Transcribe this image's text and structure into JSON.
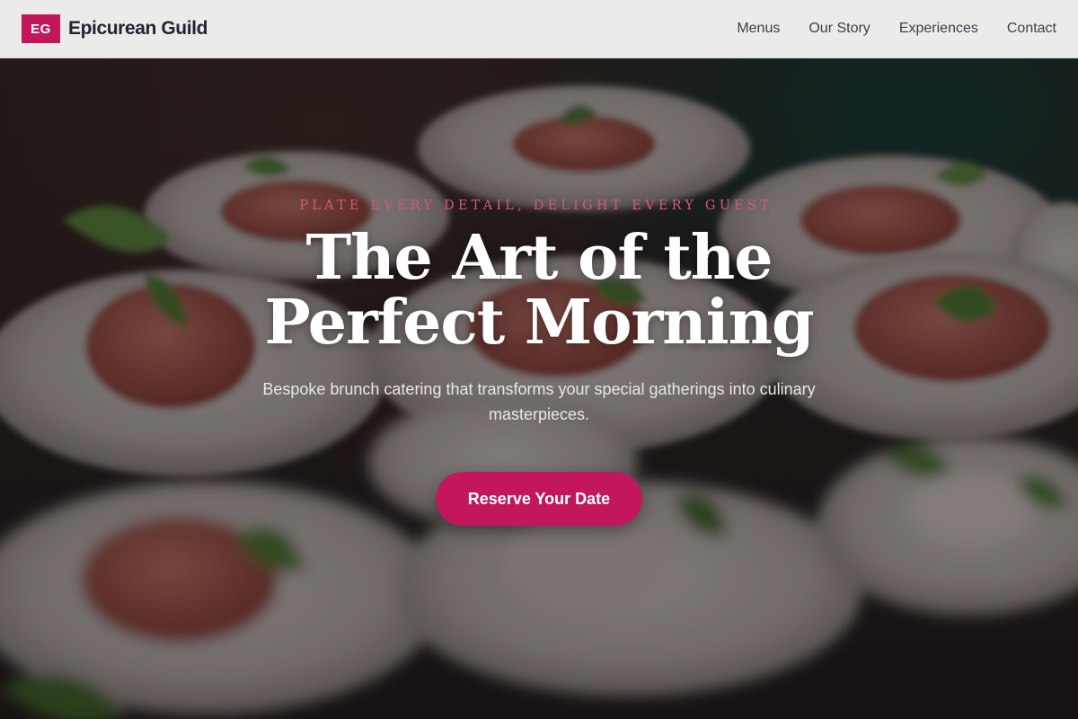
{
  "header": {
    "logo_mark": "EG",
    "brand_name": "Epicurean Guild",
    "nav": [
      "Menus",
      "Our Story",
      "Experiences",
      "Contact"
    ]
  },
  "hero": {
    "tagline": "PLATE EVERY DETAIL, DELIGHT EVERY GUEST.",
    "title": "The Art of the Perfect Morning",
    "subtitle": "Bespoke brunch catering that transforms your special gatherings into culinary masterpieces.",
    "cta_label": "Reserve Your Date",
    "background_image": "plated-prosciutto-appetizers"
  },
  "colors": {
    "accent": "#c2185b",
    "tagline": "#d9567f",
    "header_bg": "#ebebea",
    "text_dark": "#1f2430"
  }
}
